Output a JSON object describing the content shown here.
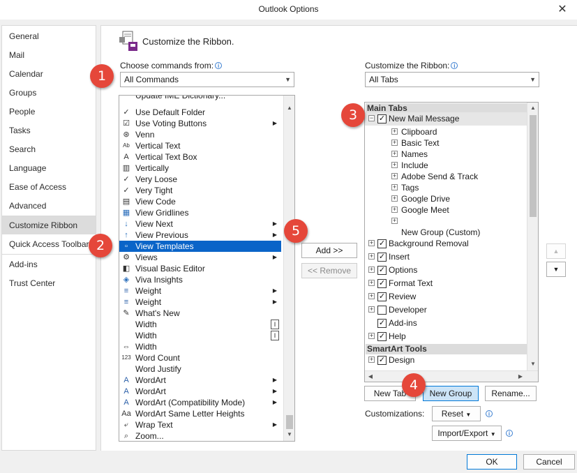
{
  "window": {
    "title": "Outlook Options",
    "close_glyph": "✕"
  },
  "nav": {
    "items": [
      {
        "label": "General"
      },
      {
        "label": "Mail"
      },
      {
        "label": "Calendar"
      },
      {
        "label": "Groups"
      },
      {
        "label": "People"
      },
      {
        "label": "Tasks"
      },
      {
        "label": "Search"
      },
      {
        "label": "Language"
      },
      {
        "label": "Ease of Access"
      },
      {
        "label": "Advanced"
      },
      {
        "label": "Customize Ribbon",
        "selected": true
      },
      {
        "label": "Quick Access Toolbar"
      },
      {
        "label": "Add-ins"
      },
      {
        "label": "Trust Center"
      }
    ]
  },
  "header": {
    "title": "Customize the Ribbon."
  },
  "left_panel": {
    "label": "Choose commands from:",
    "combo_value": "All Commands",
    "partial_item": "Update IME Dictionary...",
    "commands": [
      {
        "label": "Use Default Folder",
        "icon": "check-icon"
      },
      {
        "label": "Use Voting Buttons",
        "icon": "voting-icon",
        "submenu": true
      },
      {
        "label": "Venn",
        "icon": "venn-icon"
      },
      {
        "label": "Vertical Text",
        "icon": "vertical-text-icon"
      },
      {
        "label": "Vertical Text Box",
        "icon": "text-box-icon"
      },
      {
        "label": "Vertically",
        "icon": "align-vertical-icon"
      },
      {
        "label": "Very Loose",
        "icon": "check-icon"
      },
      {
        "label": "Very Tight",
        "icon": "check-icon"
      },
      {
        "label": "View Code",
        "icon": "view-code-icon"
      },
      {
        "label": "View Gridlines",
        "icon": "gridlines-icon"
      },
      {
        "label": "View Next",
        "icon": "arrow-down-icon",
        "submenu": true
      },
      {
        "label": "View Previous",
        "icon": "arrow-up-icon",
        "submenu": true
      },
      {
        "label": "View Templates",
        "icon": "templates-icon",
        "selected": true
      },
      {
        "label": "Views",
        "icon": "views-icon",
        "submenu": true
      },
      {
        "label": "Visual Basic Editor",
        "icon": "vba-icon"
      },
      {
        "label": "Viva Insights",
        "icon": "viva-icon"
      },
      {
        "label": "Weight",
        "icon": "weight-icon",
        "submenu": true
      },
      {
        "label": "Weight",
        "icon": "weight-icon",
        "submenu": true
      },
      {
        "label": "What's New",
        "icon": "whats-new-icon"
      },
      {
        "label": "Width",
        "icon": "none",
        "box": true
      },
      {
        "label": "Width",
        "icon": "none",
        "box": true
      },
      {
        "label": "Width",
        "icon": "width-icon"
      },
      {
        "label": "Word Count",
        "icon": "word-count-icon"
      },
      {
        "label": "Word Justify",
        "icon": "word-justify-icon"
      },
      {
        "label": "WordArt",
        "icon": "wordart-icon",
        "submenu": true
      },
      {
        "label": "WordArt",
        "icon": "wordart-icon",
        "submenu": true
      },
      {
        "label": "WordArt (Compatibility Mode)",
        "icon": "wordart-icon",
        "submenu": true
      },
      {
        "label": "WordArt Same Letter Heights",
        "icon": "letter-heights-icon"
      },
      {
        "label": "Wrap Text",
        "icon": "wrap-text-icon",
        "submenu": true
      },
      {
        "label": "Zoom...",
        "icon": "zoom-icon"
      }
    ]
  },
  "middle": {
    "add_label": "Add >>",
    "remove_label": "<< Remove"
  },
  "right_panel": {
    "label": "Customize the Ribbon:",
    "combo_value": "All Tabs",
    "group_main": "Main Tabs",
    "group_smartart": "SmartArt Tools",
    "tree": [
      {
        "label": "New Mail Message",
        "level": 0,
        "expander": "⊟",
        "checked": true,
        "highlight": true
      },
      {
        "label": "Clipboard",
        "level": 1,
        "expander": "+"
      },
      {
        "label": "Basic Text",
        "level": 1,
        "expander": "+"
      },
      {
        "label": "Names",
        "level": 1,
        "expander": "+"
      },
      {
        "label": "Include",
        "level": 1,
        "expander": "+"
      },
      {
        "label": "Adobe Send & Track",
        "level": 1,
        "expander": "+"
      },
      {
        "label": "Tags",
        "level": 1,
        "expander": "+"
      },
      {
        "label": "Google Drive",
        "level": 1,
        "expander": "+"
      },
      {
        "label": "Google Meet",
        "level": 1,
        "expander": "+"
      },
      {
        "label": "",
        "level": 1,
        "expander": "+"
      },
      {
        "label": "New Group (Custom)",
        "level": 2,
        "expander": ""
      },
      {
        "label": "Background Removal",
        "level": 0,
        "expander": "+",
        "checked": true
      },
      {
        "label": "Insert",
        "level": 0,
        "expander": "+",
        "checked": true
      },
      {
        "label": "Options",
        "level": 0,
        "expander": "+",
        "checked": true
      },
      {
        "label": "Format Text",
        "level": 0,
        "expander": "+",
        "checked": true
      },
      {
        "label": "Review",
        "level": 0,
        "expander": "+",
        "checked": true
      },
      {
        "label": "Developer",
        "level": 0,
        "expander": "+",
        "checked": false
      },
      {
        "label": "Add-ins",
        "level": 0,
        "expander": "",
        "checked": true
      },
      {
        "label": "Help",
        "level": 0,
        "expander": "+",
        "checked": true
      }
    ],
    "smartart_tree": [
      {
        "label": "Design",
        "expander": "+",
        "checked": true
      }
    ]
  },
  "bottom_buttons": {
    "new_tab": "New Tab",
    "new_group": "New Group",
    "rename": "Rename...",
    "customizations_label": "Customizations:",
    "reset": "Reset",
    "import_export": "Import/Export"
  },
  "dialog_buttons": {
    "ok": "OK",
    "cancel": "Cancel"
  },
  "callouts": [
    "1",
    "2",
    "3",
    "4",
    "5"
  ],
  "colors": {
    "selection": "#0a64c8",
    "callout": "#e5473a",
    "hover_blue": "#cce4f7"
  }
}
